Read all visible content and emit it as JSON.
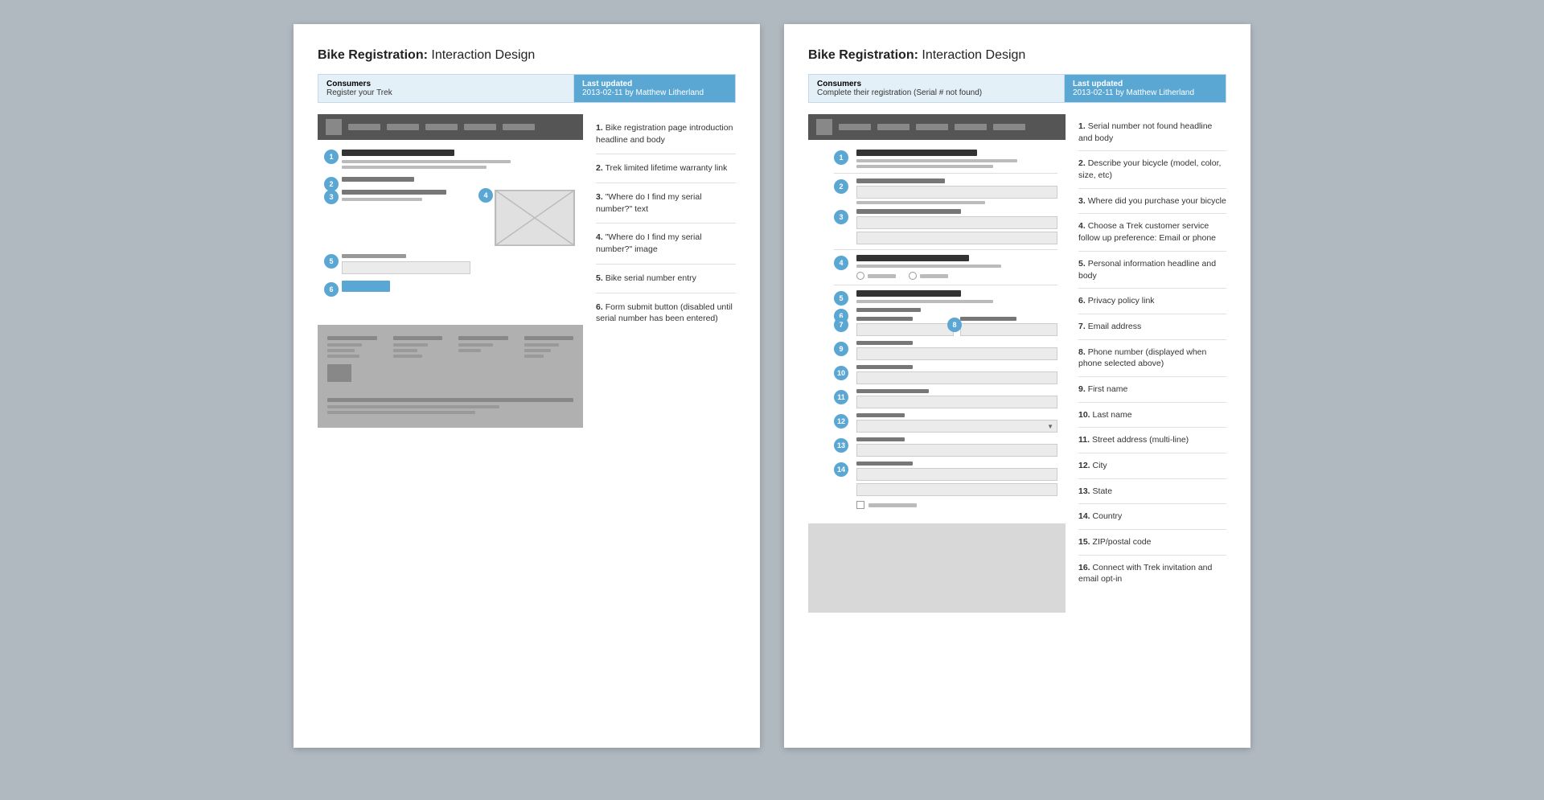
{
  "left_panel": {
    "title": "Bike Registration:",
    "title_sub": " Interaction Design",
    "meta": {
      "section_label": "Consumers",
      "section_value": "Register your Trek",
      "updated_label": "Last updated",
      "updated_value": "2013-02-11 by Matthew Litherland"
    },
    "notes": [
      {
        "id": "1",
        "text": "Bike registration page introduction headline and body"
      },
      {
        "id": "2",
        "text": "Trek limited lifetime warranty link"
      },
      {
        "id": "3",
        "text": "\"Where do I find my serial number?\" text"
      },
      {
        "id": "4",
        "text": "\"Where do I find my serial number?\" image"
      },
      {
        "id": "5",
        "text": "Bike serial number entry"
      },
      {
        "id": "6",
        "text": "Form submit button (disabled until serial number has been entered)"
      }
    ]
  },
  "right_panel": {
    "title": "Bike Registration:",
    "title_sub": " Interaction Design",
    "meta": {
      "section_label": "Consumers",
      "section_value": "Complete their registration (Serial # not found)",
      "updated_label": "Last updated",
      "updated_value": "2013-02-11 by Matthew Litherland"
    },
    "notes": [
      {
        "id": "1",
        "text": "Serial number not found headline and body"
      },
      {
        "id": "2",
        "text": "Describe your bicycle (model, color, size, etc)"
      },
      {
        "id": "3",
        "text": "Where did you purchase your bicycle"
      },
      {
        "id": "4",
        "text": "Choose a Trek customer service follow up preference: Email or phone"
      },
      {
        "id": "5",
        "text": "Personal information headline and body"
      },
      {
        "id": "6",
        "text": "Privacy policy link"
      },
      {
        "id": "7",
        "text": "Email address"
      },
      {
        "id": "8",
        "text": "Phone number (displayed when phone selected above)"
      },
      {
        "id": "9",
        "text": "First name"
      },
      {
        "id": "10",
        "text": "Last name"
      },
      {
        "id": "11",
        "text": "Street address (multi-line)"
      },
      {
        "id": "12",
        "text": "City"
      },
      {
        "id": "13",
        "text": "State"
      },
      {
        "id": "14",
        "text": "Country"
      },
      {
        "id": "15",
        "text": "ZIP/postal code"
      },
      {
        "id": "16",
        "text": "Connect with Trek invitation and email opt-in"
      }
    ]
  }
}
